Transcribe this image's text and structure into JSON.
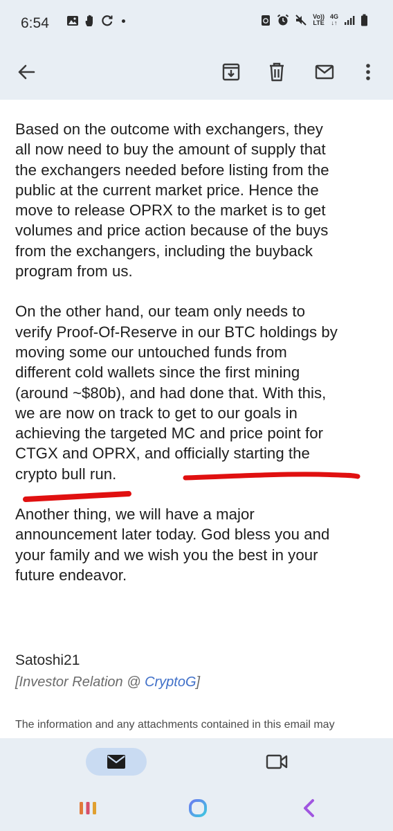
{
  "status_bar": {
    "time": "6:54",
    "signal_text_top": "Vo))",
    "signal_text_bottom": "LTE",
    "network_top": "4G",
    "network_bottom": "↓↑"
  },
  "email": {
    "paragraphs": [
      "Based on the outcome with exchangers, they\nall now need to buy the amount of supply that\nthe exchangers needed before listing from the\npublic at the current market price. Hence the\nmove to release OPRX to the market is to get\nvolumes and price action because of the buys\nfrom the exchangers, including the buyback\nprogram from us.",
      "On the other hand, our team only needs to\nverify Proof-Of-Reserve in our BTC holdings by\nmoving some our untouched funds from\ndifferent cold wallets since the first mining\n(around ~$80b), and had done that. With this,\nwe are now on track to get to our goals in\nachieving the targeted MC and price point for\nCTGX and OPRX, and officially starting the\ncrypto bull run.",
      "Another thing, we will have a major\nannouncement later today. God bless you and\nyour family and we wish you the best in your\nfuture endeavor."
    ],
    "signature_name": "Satoshi21",
    "signature_role_prefix": "[Investor Relation @ ",
    "signature_company": "CryptoG",
    "signature_role_suffix": "]",
    "disclaimer": "The information and any attachments contained in this email may"
  },
  "colors": {
    "chrome_bg": "#e8eef4",
    "underline": "#e01010",
    "link": "#3f6fc8",
    "nav_pill": "#c9dbf2"
  },
  "icons": {
    "back": "arrow-left-icon",
    "archive": "archive-icon",
    "delete": "trash-icon",
    "mark_unread": "envelope-icon",
    "more": "more-vert-icon",
    "mail_tab": "mail-icon",
    "meet_tab": "video-camera-icon",
    "recents": "recents-icon",
    "home": "home-icon",
    "system_back": "system-back-icon"
  }
}
